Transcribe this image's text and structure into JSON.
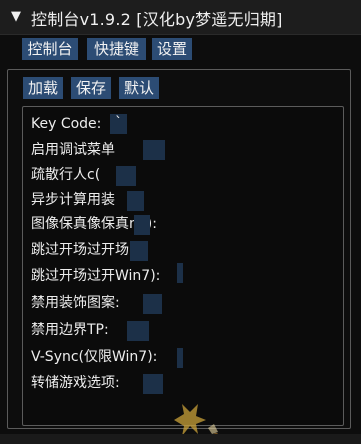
{
  "title": {
    "arrow": "▼",
    "text": "控制台v1.9.2 [汉化by梦遥无归期]"
  },
  "tabs": [
    {
      "label": "控制台"
    },
    {
      "label": "快捷键"
    },
    {
      "label": "设置"
    }
  ],
  "buttons": [
    {
      "label": "加载"
    },
    {
      "label": "保存"
    },
    {
      "label": "默认"
    }
  ],
  "rows": [
    {
      "label": "Key Code:",
      "value": "`"
    },
    {
      "label": "启用调试菜单",
      "value": ""
    },
    {
      "label": "疏散行人c(",
      "value": ""
    },
    {
      "label": "异步计算用装",
      "value": ""
    },
    {
      "label": "图像保真像保真n7):",
      "value": ""
    },
    {
      "label": "跳过开场过开场",
      "value": ""
    },
    {
      "label": "跳过开场过开Win7):",
      "value": ""
    },
    {
      "label": "禁用装饰图案:",
      "value": ""
    },
    {
      "label": "禁用边界TP:",
      "value": ""
    },
    {
      "label": "V-Sync(仅限Win7):",
      "value": ""
    },
    {
      "label": "转储游戏选项:",
      "value": ""
    }
  ],
  "colors": {
    "button_bg": "#2c4c74",
    "input_bg": "#1c3048",
    "border": "#5b5b5b",
    "text": "#ededed"
  }
}
